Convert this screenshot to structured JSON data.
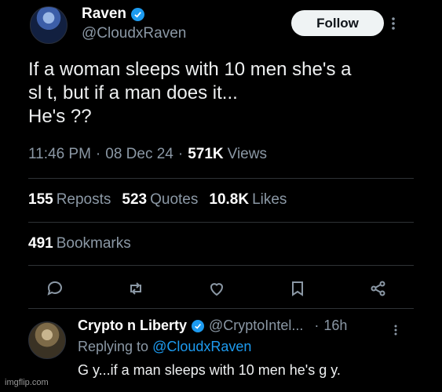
{
  "tweet": {
    "author_name": "Raven",
    "author_handle": "@CloudxRaven",
    "follow_label": "Follow",
    "text": "If a woman sleeps with 10 men she's a\nsl  t, but if a man does it...\nHe's ??",
    "time": "11:46 PM",
    "date": "08 Dec 24",
    "views_count": "571K",
    "views_label": "Views",
    "separator": "·",
    "reposts_count": "155",
    "reposts_label": "Reposts",
    "quotes_count": "523",
    "quotes_label": "Quotes",
    "likes_count": "10.8K",
    "likes_label": "Likes",
    "bookmarks_count": "491",
    "bookmarks_label": "Bookmarks"
  },
  "actions": [
    "reply-icon",
    "repost-icon",
    "like-icon",
    "bookmark-icon",
    "share-icon"
  ],
  "reply": {
    "author_name": "Crypto n Liberty",
    "author_handle": "@CryptoIntel...",
    "age": "16h",
    "separator": "·",
    "replying_prefix": "Replying to",
    "replying_to": "@CloudxRaven",
    "text": "G  y...if a man sleeps with 10 men he's g  y."
  },
  "watermark": "imgflip.com",
  "colors": {
    "background": "#000000",
    "accent": "#1d9bf0",
    "muted": "#8b98a5",
    "follow_bg": "#eff3f4"
  }
}
